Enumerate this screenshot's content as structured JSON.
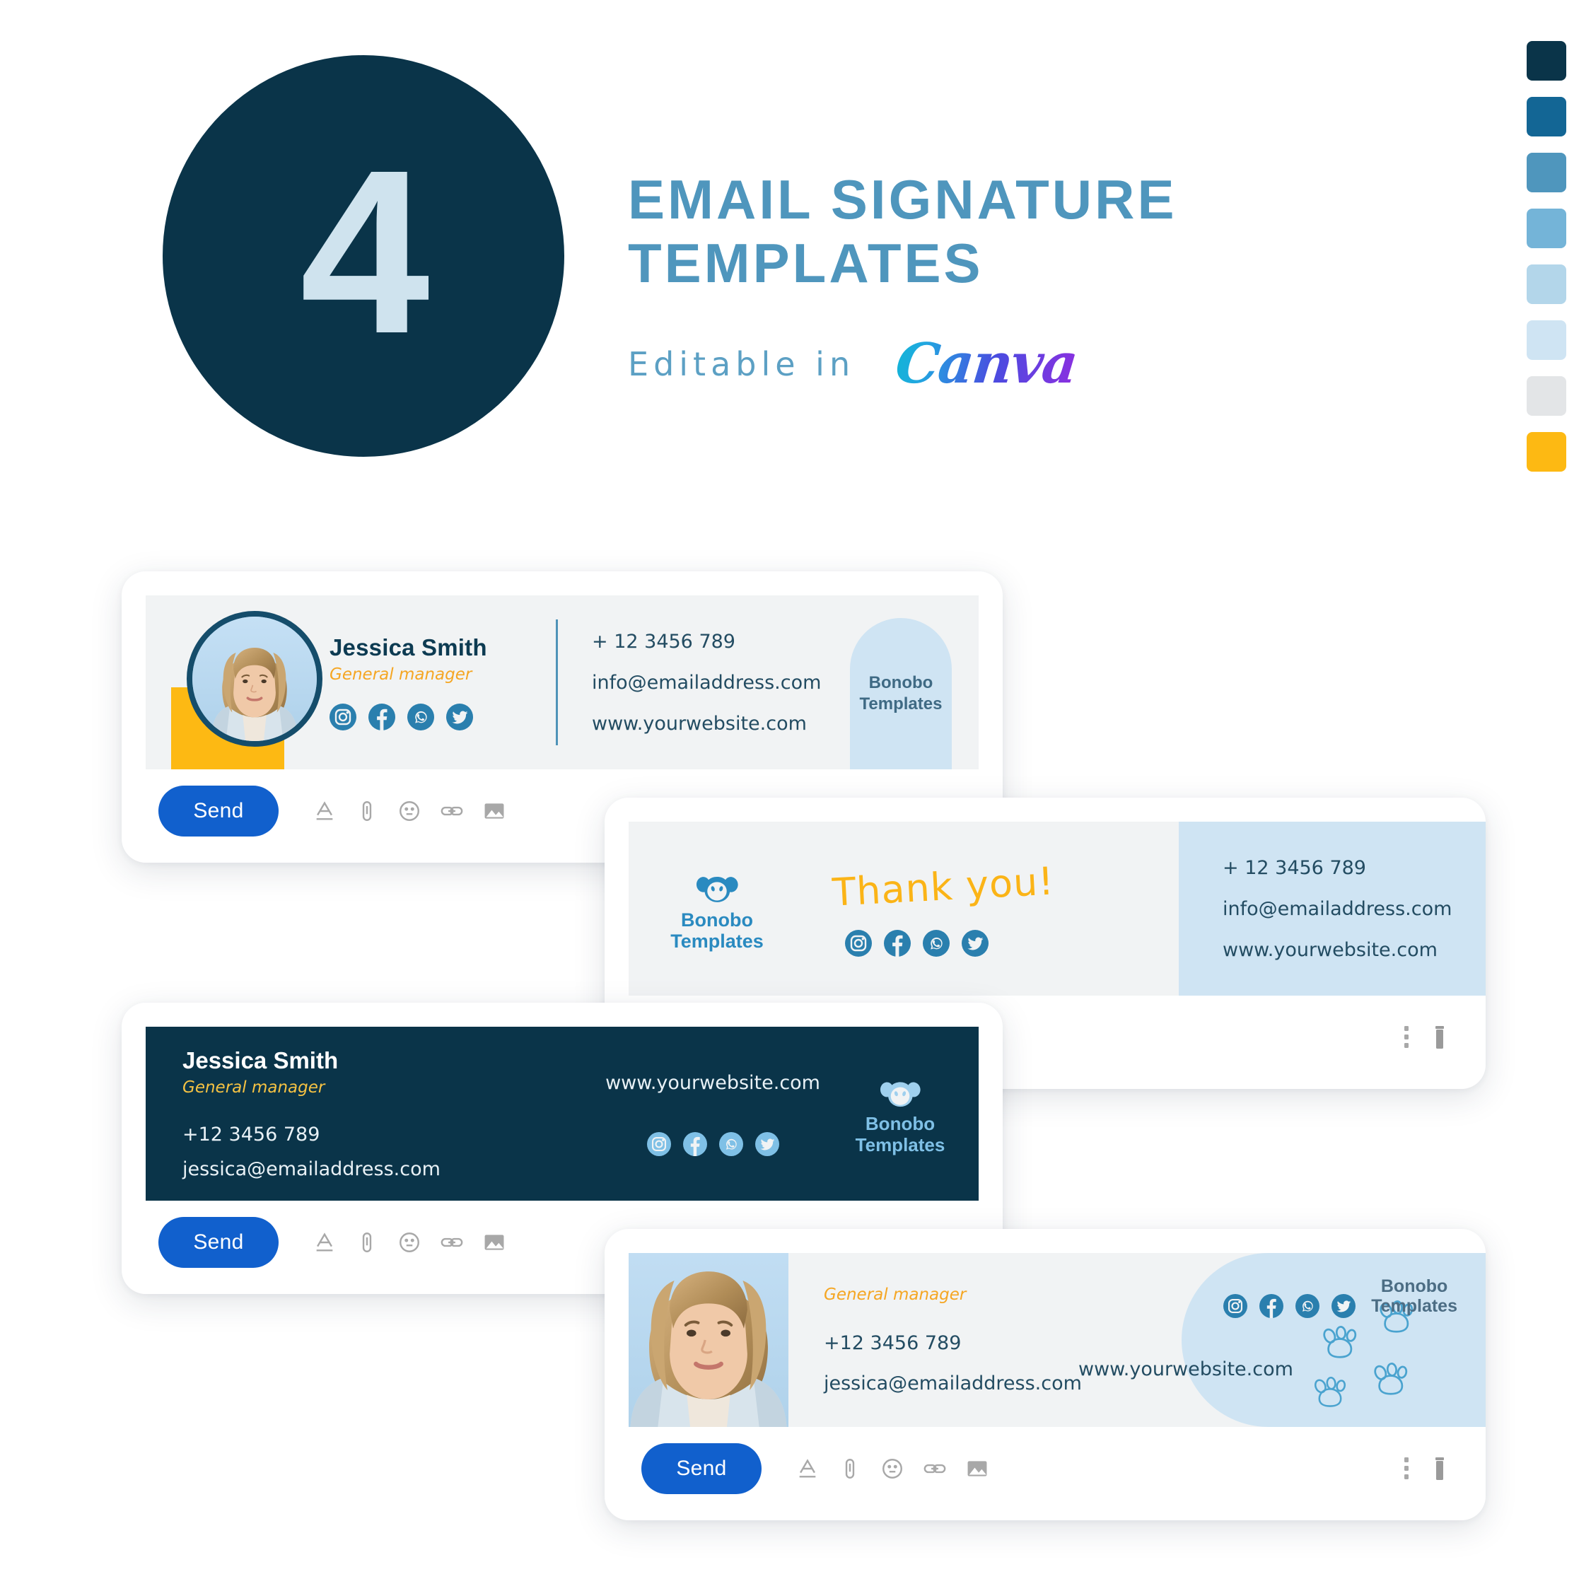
{
  "header": {
    "number": "4",
    "title_line1": "EMAIL SIGNATURE",
    "title_line2": "TEMPLATES",
    "subtitle": "Editable in",
    "brand": "Canva"
  },
  "palette": {
    "swatches": [
      "#0a3449",
      "#136695",
      "#4f96bd",
      "#74b4d8",
      "#b3d6ea",
      "#cfe4f3",
      "#e3e5e7",
      "#fdb913"
    ],
    "navy": "#0a3449",
    "accent_blue": "#4f96bd",
    "yellow": "#fdb913",
    "send_blue": "#1160cd",
    "social_blue": "#2a7fae"
  },
  "toolbar": {
    "send_label": "Send",
    "icons": [
      "text-format-icon",
      "attachment-icon",
      "emoji-icon",
      "link-icon",
      "image-icon"
    ],
    "right_icons": [
      "more-options-icon",
      "delete-icon"
    ]
  },
  "social_icons": [
    "instagram-icon",
    "facebook-icon",
    "whatsapp-icon",
    "twitter-icon"
  ],
  "cards": [
    {
      "id": "card1",
      "name": "Jessica Smith",
      "role": "General manager",
      "phone": "+ 12 3456 789",
      "email": "info@emailaddress.com",
      "website": "www.yourwebsite.com",
      "logo_line1": "Bonobo",
      "logo_line2": "Templates"
    },
    {
      "id": "card2",
      "greeting": "Thank you!",
      "phone": "+ 12 3456 789",
      "email": "info@emailaddress.com",
      "website": "www.yourwebsite.com",
      "logo_line1": "Bonobo",
      "logo_line2": "Templates"
    },
    {
      "id": "card3",
      "name": "Jessica Smith",
      "role": "General manager",
      "phone": "+12 3456 789",
      "email": "jessica@emailaddress.com",
      "website": "www.yourwebsite.com",
      "logo_line1": "Bonobo",
      "logo_line2": "Templates"
    },
    {
      "id": "card4",
      "role": "General manager",
      "phone": "+12 3456 789",
      "email": "jessica@emailaddress.com",
      "website": "www.yourwebsite.com",
      "logo_line1": "Bonobo",
      "logo_line2": "Templates"
    }
  ]
}
